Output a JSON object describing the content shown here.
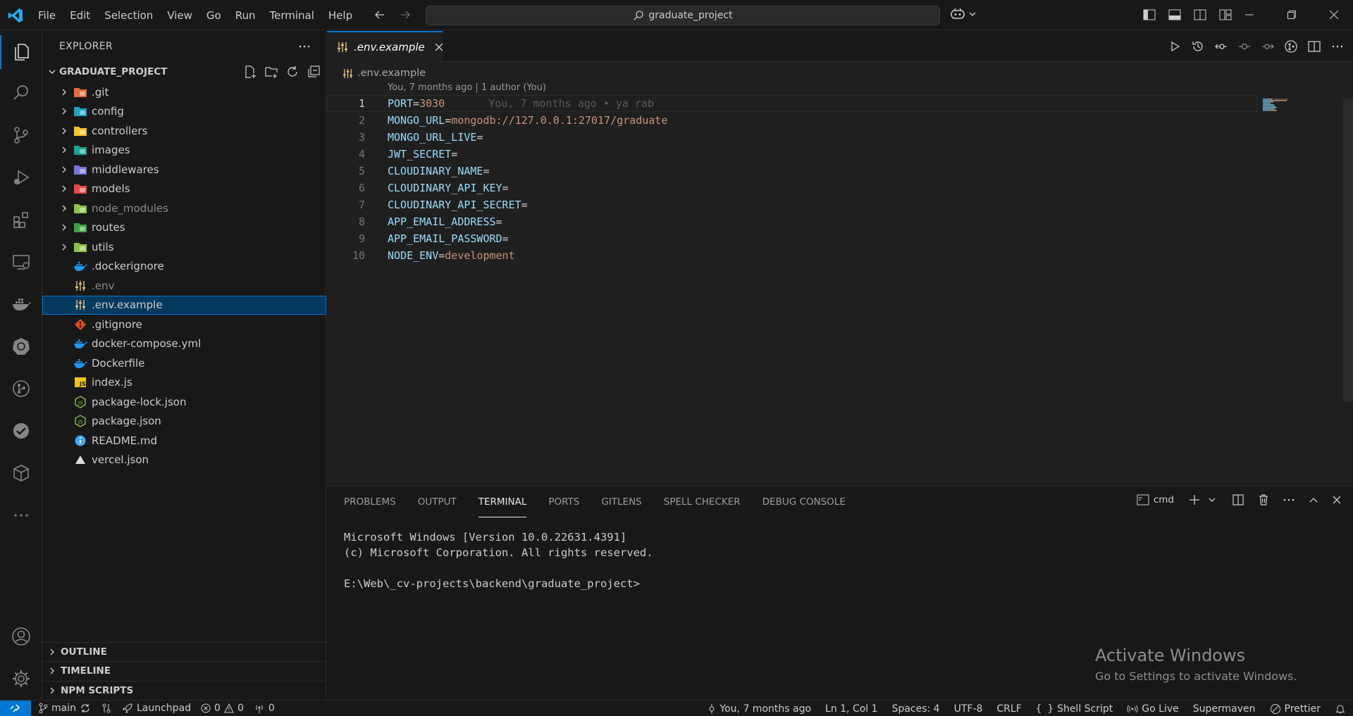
{
  "titlebar": {
    "menu": [
      "File",
      "Edit",
      "Selection",
      "View",
      "Go",
      "Run",
      "Terminal",
      "Help"
    ],
    "search": "graduate_project"
  },
  "sidebar": {
    "title": "EXPLORER",
    "project": "GRADUATE_PROJECT",
    "tree": [
      {
        "name": ".git",
        "type": "folder",
        "icon": "git-folder-icon",
        "color": "#e06c3c"
      },
      {
        "name": "config",
        "type": "folder",
        "icon": "config-folder-icon",
        "color": "#20a0c0"
      },
      {
        "name": "controllers",
        "type": "folder",
        "icon": "controllers-folder-icon",
        "color": "#f2c230"
      },
      {
        "name": "images",
        "type": "folder",
        "icon": "images-folder-icon",
        "color": "#1aa394"
      },
      {
        "name": "middlewares",
        "type": "folder",
        "icon": "middlewares-folder-icon",
        "color": "#7a74d8"
      },
      {
        "name": "models",
        "type": "folder",
        "icon": "models-folder-icon",
        "color": "#e24b4b"
      },
      {
        "name": "node_modules",
        "type": "folder",
        "icon": "node-modules-folder-icon",
        "color": "#8bc34a",
        "dim": true
      },
      {
        "name": "routes",
        "type": "folder",
        "icon": "routes-folder-icon",
        "color": "#43a047"
      },
      {
        "name": "utils",
        "type": "folder",
        "icon": "utils-folder-icon",
        "color": "#8bc34a"
      },
      {
        "name": ".dockerignore",
        "type": "file",
        "icon": "docker-icon",
        "color": "#2496ed"
      },
      {
        "name": ".env",
        "type": "file",
        "icon": "env-settings-icon",
        "color": "#e5c07b",
        "dim": true
      },
      {
        "name": ".env.example",
        "type": "file",
        "icon": "env-settings-icon",
        "color": "#e5c07b",
        "selected": true
      },
      {
        "name": ".gitignore",
        "type": "file",
        "icon": "git-icon",
        "color": "#e64a19"
      },
      {
        "name": "docker-compose.yml",
        "type": "file",
        "icon": "docker-icon",
        "color": "#2496ed"
      },
      {
        "name": "Dockerfile",
        "type": "file",
        "icon": "docker-icon",
        "color": "#2496ed"
      },
      {
        "name": "index.js",
        "type": "file",
        "icon": "javascript-icon",
        "color": "#f0c419"
      },
      {
        "name": "package-lock.json",
        "type": "file",
        "icon": "nodejs-icon",
        "color": "#8bc34a"
      },
      {
        "name": "package.json",
        "type": "file",
        "icon": "nodejs-icon",
        "color": "#8bc34a"
      },
      {
        "name": "README.md",
        "type": "file",
        "icon": "info-icon",
        "color": "#42a5f5"
      },
      {
        "name": "vercel.json",
        "type": "file",
        "icon": "vercel-icon",
        "color": "#dddddd"
      }
    ],
    "sections": [
      "OUTLINE",
      "TIMELINE",
      "NPM SCRIPTS"
    ]
  },
  "editor": {
    "tab": ".env.example",
    "breadcrumb": ".env.example",
    "codelens": "You, 7 months ago | 1 author (You)",
    "blame": "You, 7 months ago • ya rab",
    "lines": [
      {
        "n": "1",
        "key": "PORT",
        "val": "3030"
      },
      {
        "n": "2",
        "key": "MONGO_URL",
        "val": "mongodb://127.0.0.1:27017/graduate"
      },
      {
        "n": "3",
        "key": "MONGO_URL_LIVE",
        "val": ""
      },
      {
        "n": "4",
        "key": "JWT_SECRET",
        "val": ""
      },
      {
        "n": "5",
        "key": "CLOUDINARY_NAME",
        "val": ""
      },
      {
        "n": "6",
        "key": "CLOUDINARY_API_KEY",
        "val": ""
      },
      {
        "n": "7",
        "key": "CLOUDINARY_API_SECRET",
        "val": ""
      },
      {
        "n": "8",
        "key": "APP_EMAIL_ADDRESS",
        "val": ""
      },
      {
        "n": "9",
        "key": "APP_EMAIL_PASSWORD",
        "val": ""
      },
      {
        "n": "10",
        "key": "NODE_ENV",
        "val": "development"
      }
    ]
  },
  "panel": {
    "tabs": [
      "PROBLEMS",
      "OUTPUT",
      "TERMINAL",
      "PORTS",
      "GITLENS",
      "SPELL CHECKER",
      "DEBUG CONSOLE"
    ],
    "active_tab": "TERMINAL",
    "shell": "cmd",
    "terminal_lines": [
      "Microsoft Windows [Version 10.0.22631.4391]",
      "(c) Microsoft Corporation. All rights reserved.",
      "",
      "E:\\Web\\_cv-projects\\backend\\graduate_project>"
    ]
  },
  "watermark": {
    "title": "Activate Windows",
    "subtitle": "Go to Settings to activate Windows."
  },
  "statusbar": {
    "branch": "main",
    "launchpad": "Launchpad",
    "errors": "0",
    "warnings": "0",
    "ports": "0",
    "blame": "You, 7 months ago",
    "position": "Ln 1, Col 1",
    "spaces": "Spaces: 4",
    "encoding": "UTF-8",
    "eol": "CRLF",
    "language": "Shell Script",
    "golive": "Go Live",
    "maven": "Supermaven",
    "prettier": "Prettier"
  }
}
